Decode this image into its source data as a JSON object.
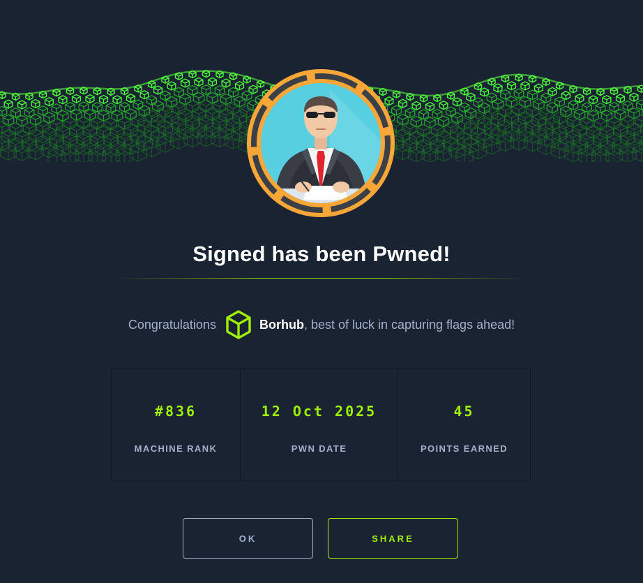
{
  "modal": {
    "title": "Signed has been Pwned!",
    "congrats_prefix": "Congratulations",
    "username": "Borhub",
    "congrats_suffix": ", best of luck in capturing flags ahead!"
  },
  "stats": [
    {
      "value": "#836",
      "label": "MACHINE RANK"
    },
    {
      "value": "12 Oct 2025",
      "label": "PWN DATE"
    },
    {
      "value": "45",
      "label": "POINTS EARNED"
    }
  ],
  "buttons": {
    "ok": "OK",
    "share": "SHARE"
  },
  "icons": {
    "banner": "green-cube-wave-banner",
    "avatar": "machine-avatar-signing-man",
    "user_rank": "green-cube-icon"
  },
  "colors": {
    "background": "#1a2332",
    "accent_green": "#9fef00",
    "muted_text": "#a4b1cd",
    "avatar_ring": "#f7a637",
    "avatar_bg": "#57cfe0"
  }
}
